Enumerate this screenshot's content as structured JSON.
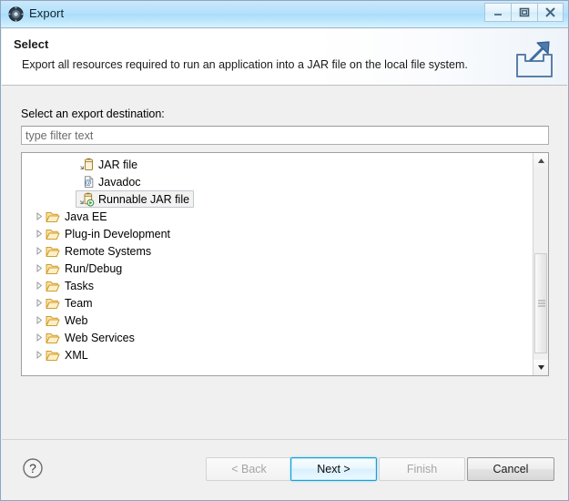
{
  "window": {
    "title": "Export",
    "title_icon": "eclipse-export-icon",
    "controls": {
      "minimize": "minimize-button",
      "maximize": "maximize-button",
      "close": "close-button"
    }
  },
  "header": {
    "title": "Select",
    "description": "Export all resources required to run an application into a JAR file on the local file system.",
    "banner_icon": "export-arrow-icon"
  },
  "form": {
    "destination_label": "Select an export destination:",
    "filter": {
      "value": "",
      "placeholder": "type filter text"
    }
  },
  "tree": {
    "items": [
      {
        "label": "JAR file",
        "icon": "jar-file-icon",
        "level": "child",
        "expandable": false,
        "selected": false
      },
      {
        "label": "Javadoc",
        "icon": "javadoc-icon",
        "level": "child",
        "expandable": false,
        "selected": false
      },
      {
        "label": "Runnable JAR file",
        "icon": "runnable-jar-file-icon",
        "level": "child",
        "expandable": false,
        "selected": true
      },
      {
        "label": "Java EE",
        "icon": "folder-icon",
        "level": "top",
        "expandable": true,
        "selected": false
      },
      {
        "label": "Plug-in Development",
        "icon": "folder-icon",
        "level": "top",
        "expandable": true,
        "selected": false
      },
      {
        "label": "Remote Systems",
        "icon": "folder-icon",
        "level": "top",
        "expandable": true,
        "selected": false
      },
      {
        "label": "Run/Debug",
        "icon": "folder-icon",
        "level": "top",
        "expandable": true,
        "selected": false
      },
      {
        "label": "Tasks",
        "icon": "folder-icon",
        "level": "top",
        "expandable": true,
        "selected": false
      },
      {
        "label": "Team",
        "icon": "folder-icon",
        "level": "top",
        "expandable": true,
        "selected": false
      },
      {
        "label": "Web",
        "icon": "folder-icon",
        "level": "top",
        "expandable": true,
        "selected": false
      },
      {
        "label": "Web Services",
        "icon": "folder-icon",
        "level": "top",
        "expandable": true,
        "selected": false
      },
      {
        "label": "XML",
        "icon": "folder-icon",
        "level": "top",
        "expandable": true,
        "selected": false
      }
    ]
  },
  "buttons": {
    "help": "?",
    "back": "< Back",
    "next": "Next >",
    "finish": "Finish",
    "cancel": "Cancel"
  },
  "colors": {
    "titlebar": "#b3e2fc",
    "dialog_background": "#f0f0f0",
    "header_background": "#ffffff",
    "default_button_border": "#1c9fd4",
    "folder_icon": "#e8b33c",
    "selection_background": "#f2f2f2"
  }
}
